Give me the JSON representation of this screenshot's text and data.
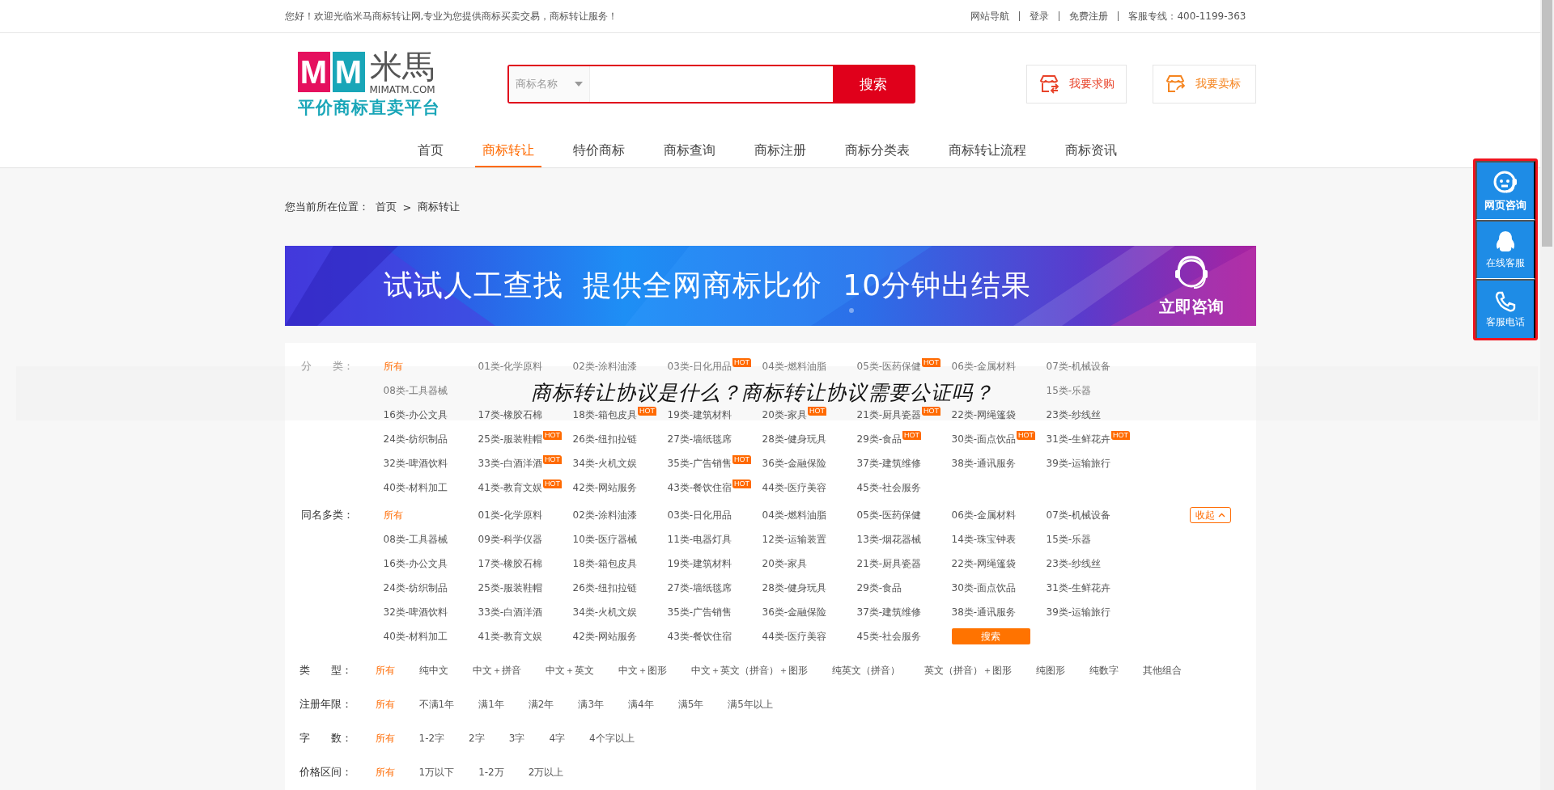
{
  "top_bar": {
    "welcome": "您好！欢迎光临米马商标转让网,专业为您提供商标买卖交易，商标转让服务！",
    "links": [
      "网站导航",
      "登录",
      "免费注册"
    ],
    "hotline": "客服专线：400-1199-363"
  },
  "logo": {
    "mark": [
      "M",
      "M"
    ],
    "name": "米馬",
    "domain": "MIMATM.COM",
    "slogan": "平价商标直卖平台"
  },
  "search": {
    "scope": "商标名称",
    "button": "搜索"
  },
  "header_buttons": [
    {
      "label": "我要求购",
      "kind": "buy"
    },
    {
      "label": "我要卖标",
      "kind": "sell"
    }
  ],
  "nav": [
    {
      "label": "首页",
      "selected": false
    },
    {
      "label": "商标转让",
      "selected": true
    },
    {
      "label": "特价商标",
      "selected": false
    },
    {
      "label": "商标查询",
      "selected": false
    },
    {
      "label": "商标注册",
      "selected": false
    },
    {
      "label": "商标分类表",
      "selected": false
    },
    {
      "label": "商标转让流程",
      "selected": false
    },
    {
      "label": "商标资讯",
      "selected": false
    }
  ],
  "breadcrumb": {
    "prefix": "您当前所在位置：",
    "items": [
      "首页",
      "商标转让"
    ],
    "separator": ">"
  },
  "banner": {
    "headline": "试试人工查找  提供全网商标比价  10分钟出结果",
    "action": "立即咨询"
  },
  "category_filter": {
    "label": "分　　类：",
    "rows": [
      {
        "items": [
          {
            "label": "所有",
            "selected": true
          },
          {
            "label": "01类-化学原料",
            "selected": false
          },
          {
            "label": "02类-涂料油漆",
            "selected": false
          },
          {
            "label": "03类-日化用品",
            "selected": false,
            "badge": "HOT"
          },
          {
            "label": "04类-燃料油脂",
            "selected": false
          },
          {
            "label": "05类-医药保健",
            "selected": false,
            "badge": "HOT"
          },
          {
            "label": "06类-金属材料",
            "selected": false
          },
          {
            "label": "07类-机械设备",
            "selected": false
          }
        ]
      },
      {
        "overlay_text": "商标转让协议是什么？商标转让协议需要公证吗？",
        "items": [
          {
            "label": "08类-工具器械",
            "selected": false
          },
          {
            "label": "15类-乐器",
            "selected": false
          }
        ]
      },
      {
        "items": [
          {
            "label": "16类-办公文具",
            "selected": false
          },
          {
            "label": "17类-橡胶石棉",
            "selected": false
          },
          {
            "label": "18类-箱包皮具",
            "selected": false,
            "badge": "HOT"
          },
          {
            "label": "19类-建筑材料",
            "selected": false
          },
          {
            "label": "20类-家具",
            "selected": false,
            "badge": "HOT"
          },
          {
            "label": "21类-厨具瓷器",
            "selected": false,
            "badge": "HOT"
          },
          {
            "label": "22类-网绳篷袋",
            "selected": false
          },
          {
            "label": "23类-纱线丝",
            "selected": false
          }
        ]
      },
      {
        "items": [
          {
            "label": "24类-纺织制品",
            "selected": false
          },
          {
            "label": "25类-服装鞋帽",
            "selected": false,
            "badge": "HOT"
          },
          {
            "label": "26类-纽扣拉链",
            "selected": false
          },
          {
            "label": "27类-墙纸毯席",
            "selected": false
          },
          {
            "label": "28类-健身玩具",
            "selected": false
          },
          {
            "label": "29类-食品",
            "selected": false,
            "badge": "HOT"
          },
          {
            "label": "30类-面点饮品",
            "selected": false,
            "badge": "HOT"
          },
          {
            "label": "31类-生鲜花卉",
            "selected": false,
            "badge": "HOT"
          }
        ]
      },
      {
        "items": [
          {
            "label": "32类-啤酒饮料",
            "selected": false
          },
          {
            "label": "33类-白酒洋酒",
            "selected": false,
            "badge": "HOT"
          },
          {
            "label": "34类-火机文娱",
            "selected": false
          },
          {
            "label": "35类-广告销售",
            "selected": false,
            "badge": "HOT"
          },
          {
            "label": "36类-金融保险",
            "selected": false
          },
          {
            "label": "37类-建筑维修",
            "selected": false
          },
          {
            "label": "38类-通讯服务",
            "selected": false
          },
          {
            "label": "39类-运输旅行",
            "selected": false
          }
        ]
      },
      {
        "items": [
          {
            "label": "40类-材料加工",
            "selected": false
          },
          {
            "label": "41类-教育文娱",
            "selected": false,
            "badge": "HOT"
          },
          {
            "label": "42类-网站服务",
            "selected": false
          },
          {
            "label": "43类-餐饮住宿",
            "selected": false,
            "badge": "HOT"
          },
          {
            "label": "44类-医疗美容",
            "selected": false
          },
          {
            "label": "45类-社会服务",
            "selected": false
          }
        ]
      }
    ]
  },
  "multi_class_filter": {
    "label": "同名多类：",
    "collapse": "收起",
    "search_button": "搜索",
    "items": [
      {
        "label": "所有",
        "selected": true
      },
      {
        "label": "01类-化学原料",
        "selected": false
      },
      {
        "label": "02类-涂料油漆",
        "selected": false
      },
      {
        "label": "03类-日化用品",
        "selected": false
      },
      {
        "label": "04类-燃料油脂",
        "selected": false
      },
      {
        "label": "05类-医药保健",
        "selected": false
      },
      {
        "label": "06类-金属材料",
        "selected": false
      },
      {
        "label": "07类-机械设备",
        "selected": false
      },
      {
        "label": "08类-工具器械",
        "selected": false
      },
      {
        "label": "09类-科学仪器",
        "selected": false
      },
      {
        "label": "10类-医疗器械",
        "selected": false
      },
      {
        "label": "11类-电器灯具",
        "selected": false
      },
      {
        "label": "12类-运输装置",
        "selected": false
      },
      {
        "label": "13类-烟花器械",
        "selected": false
      },
      {
        "label": "14类-珠宝钟表",
        "selected": false
      },
      {
        "label": "15类-乐器",
        "selected": false
      },
      {
        "label": "16类-办公文具",
        "selected": false
      },
      {
        "label": "17类-橡胶石棉",
        "selected": false
      },
      {
        "label": "18类-箱包皮具",
        "selected": false
      },
      {
        "label": "19类-建筑材料",
        "selected": false
      },
      {
        "label": "20类-家具",
        "selected": false
      },
      {
        "label": "21类-厨具瓷器",
        "selected": false
      },
      {
        "label": "22类-网绳篷袋",
        "selected": false
      },
      {
        "label": "23类-纱线丝",
        "selected": false
      },
      {
        "label": "24类-纺织制品",
        "selected": false
      },
      {
        "label": "25类-服装鞋帽",
        "selected": false
      },
      {
        "label": "26类-纽扣拉链",
        "selected": false
      },
      {
        "label": "27类-墙纸毯席",
        "selected": false
      },
      {
        "label": "28类-健身玩具",
        "selected": false
      },
      {
        "label": "29类-食品",
        "selected": false
      },
      {
        "label": "30类-面点饮品",
        "selected": false
      },
      {
        "label": "31类-生鲜花卉",
        "selected": false
      },
      {
        "label": "32类-啤酒饮料",
        "selected": false
      },
      {
        "label": "33类-白酒洋酒",
        "selected": false
      },
      {
        "label": "34类-火机文娱",
        "selected": false
      },
      {
        "label": "35类-广告销售",
        "selected": false
      },
      {
        "label": "36类-金融保险",
        "selected": false
      },
      {
        "label": "37类-建筑维修",
        "selected": false
      },
      {
        "label": "38类-通讯服务",
        "selected": false
      },
      {
        "label": "39类-运输旅行",
        "selected": false
      },
      {
        "label": "40类-材料加工",
        "selected": false
      },
      {
        "label": "41类-教育文娱",
        "selected": false
      },
      {
        "label": "42类-网站服务",
        "selected": false
      },
      {
        "label": "43类-餐饮住宿",
        "selected": false
      },
      {
        "label": "44类-医疗美容",
        "selected": false
      },
      {
        "label": "45类-社会服务",
        "selected": false
      }
    ]
  },
  "filters": [
    {
      "label": "类　　型：",
      "options": [
        {
          "label": "所有",
          "selected": true
        },
        {
          "label": "纯中文",
          "selected": false
        },
        {
          "label": "中文＋拼音",
          "selected": false
        },
        {
          "label": "中文＋英文",
          "selected": false
        },
        {
          "label": "中文＋图形",
          "selected": false
        },
        {
          "label": "中文＋英文（拼音）＋图形",
          "selected": false
        },
        {
          "label": "纯英文（拼音）",
          "selected": false
        },
        {
          "label": "英文（拼音）＋图形",
          "selected": false
        },
        {
          "label": "纯图形",
          "selected": false
        },
        {
          "label": "纯数字",
          "selected": false
        },
        {
          "label": "其他组合",
          "selected": false
        }
      ]
    },
    {
      "label": "注册年限：",
      "options": [
        {
          "label": "所有",
          "selected": true
        },
        {
          "label": "不满1年",
          "selected": false
        },
        {
          "label": "满1年",
          "selected": false
        },
        {
          "label": "满2年",
          "selected": false
        },
        {
          "label": "满3年",
          "selected": false
        },
        {
          "label": "满4年",
          "selected": false
        },
        {
          "label": "满5年",
          "selected": false
        },
        {
          "label": "满5年以上",
          "selected": false
        }
      ]
    },
    {
      "label": "字　　数：",
      "options": [
        {
          "label": "所有",
          "selected": true
        },
        {
          "label": "1-2字",
          "selected": false
        },
        {
          "label": "2字",
          "selected": false
        },
        {
          "label": "3字",
          "selected": false
        },
        {
          "label": "4字",
          "selected": false
        },
        {
          "label": "4个字以上",
          "selected": false
        }
      ]
    },
    {
      "label": "价格区间：",
      "options": [
        {
          "label": "所有",
          "selected": true
        },
        {
          "label": "1万以下",
          "selected": false
        },
        {
          "label": "1-2万",
          "selected": false
        },
        {
          "label": "2万以上",
          "selected": false
        }
      ]
    }
  ],
  "side_panel": [
    {
      "label": "网页咨询",
      "kind": "chat"
    },
    {
      "label": "在线客服",
      "kind": "penguin"
    },
    {
      "label": "客服电话",
      "kind": "phone"
    }
  ]
}
